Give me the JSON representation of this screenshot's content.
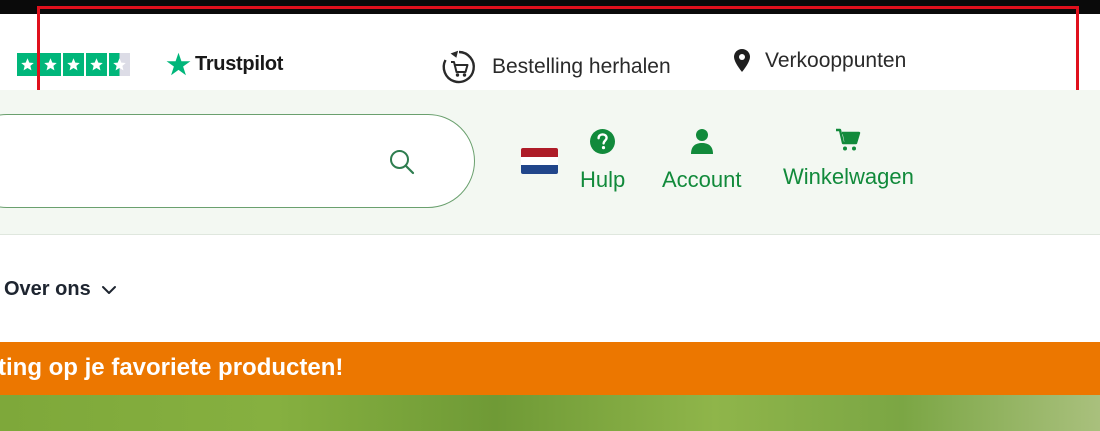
{
  "colors": {
    "brand_green": "#118a3b",
    "trustpilot_green": "#00b67a",
    "promo_orange": "#ec7700",
    "highlight_red": "#e0101c"
  },
  "trustpilot": {
    "rating_stars": 4.5,
    "max_stars": 5,
    "logo_text": "Trustpilot"
  },
  "utility": {
    "reorder_label": "Bestelling herhalen",
    "stores_label": "Verkooppunten"
  },
  "header": {
    "search_placeholder": "",
    "language": "nl",
    "help_label": "Hulp",
    "account_label": "Account",
    "cart_label": "Winkelwagen"
  },
  "menu": {
    "items": [
      {
        "label": "Over ons"
      }
    ]
  },
  "promo": {
    "text": "ting op je favoriete producten!"
  },
  "icons": [
    "star-icon",
    "trustpilot-star-icon",
    "reorder-cart-icon",
    "location-pin-icon",
    "search-icon",
    "help-icon",
    "user-icon",
    "cart-icon",
    "chevron-down-icon"
  ]
}
